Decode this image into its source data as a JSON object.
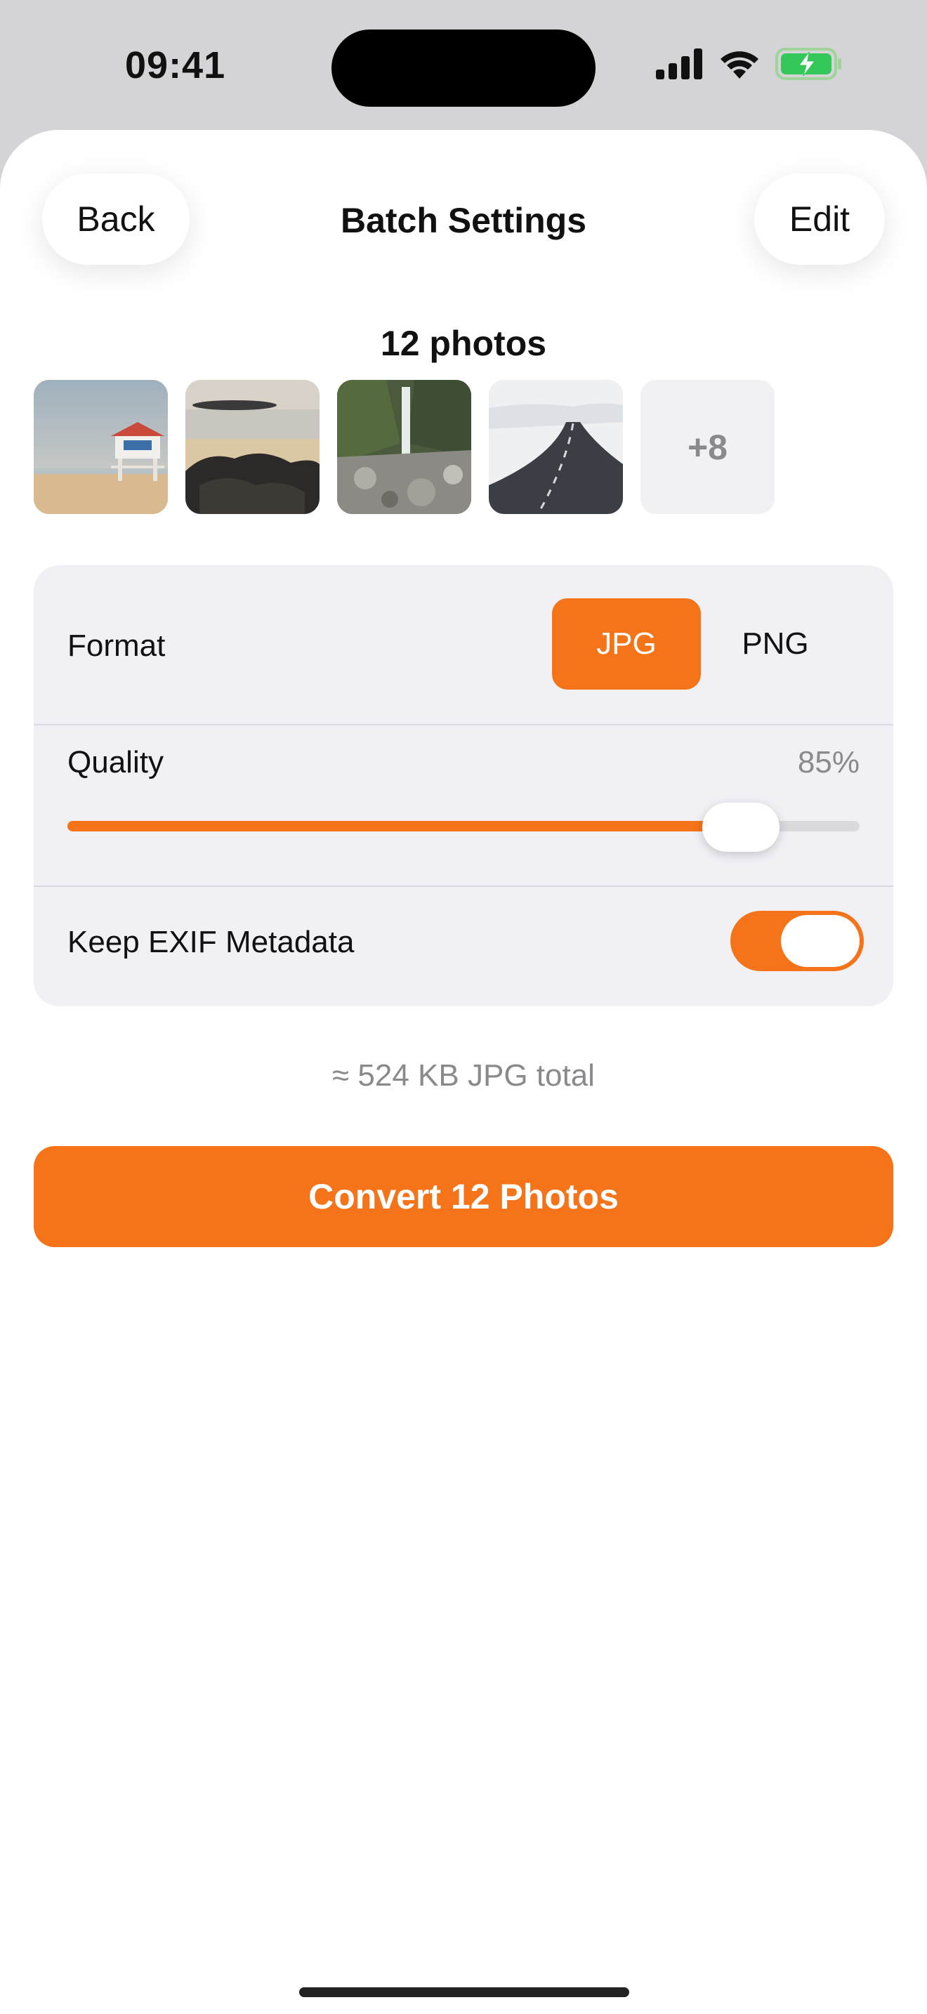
{
  "status_bar": {
    "time": "09:41",
    "icons": [
      "cellular-signal-icon",
      "wifi-icon",
      "battery-charging-icon"
    ]
  },
  "nav": {
    "back_label": "Back",
    "title": "Batch Settings",
    "edit_label": "Edit"
  },
  "photos": {
    "count_label": "12 photos",
    "thumbnails": [
      "lifeguard-tower-beach",
      "rocky-shore",
      "mountain-waterfall",
      "snowy-road"
    ],
    "more_label": "+8"
  },
  "settings": {
    "format_label": "Format",
    "format_options": [
      "JPG",
      "PNG"
    ],
    "format_selected": "JPG",
    "quality_label": "Quality",
    "quality_value": "85%",
    "quality_fraction": 0.85,
    "exif_label": "Keep EXIF Metadata",
    "exif_enabled": true
  },
  "estimate": "≈ 524 KB JPG total",
  "convert_label": "Convert 12 Photos",
  "colors": {
    "accent": "#f67419",
    "card_bg": "#f1f0f5",
    "secondary_text": "#8a8a8e"
  }
}
